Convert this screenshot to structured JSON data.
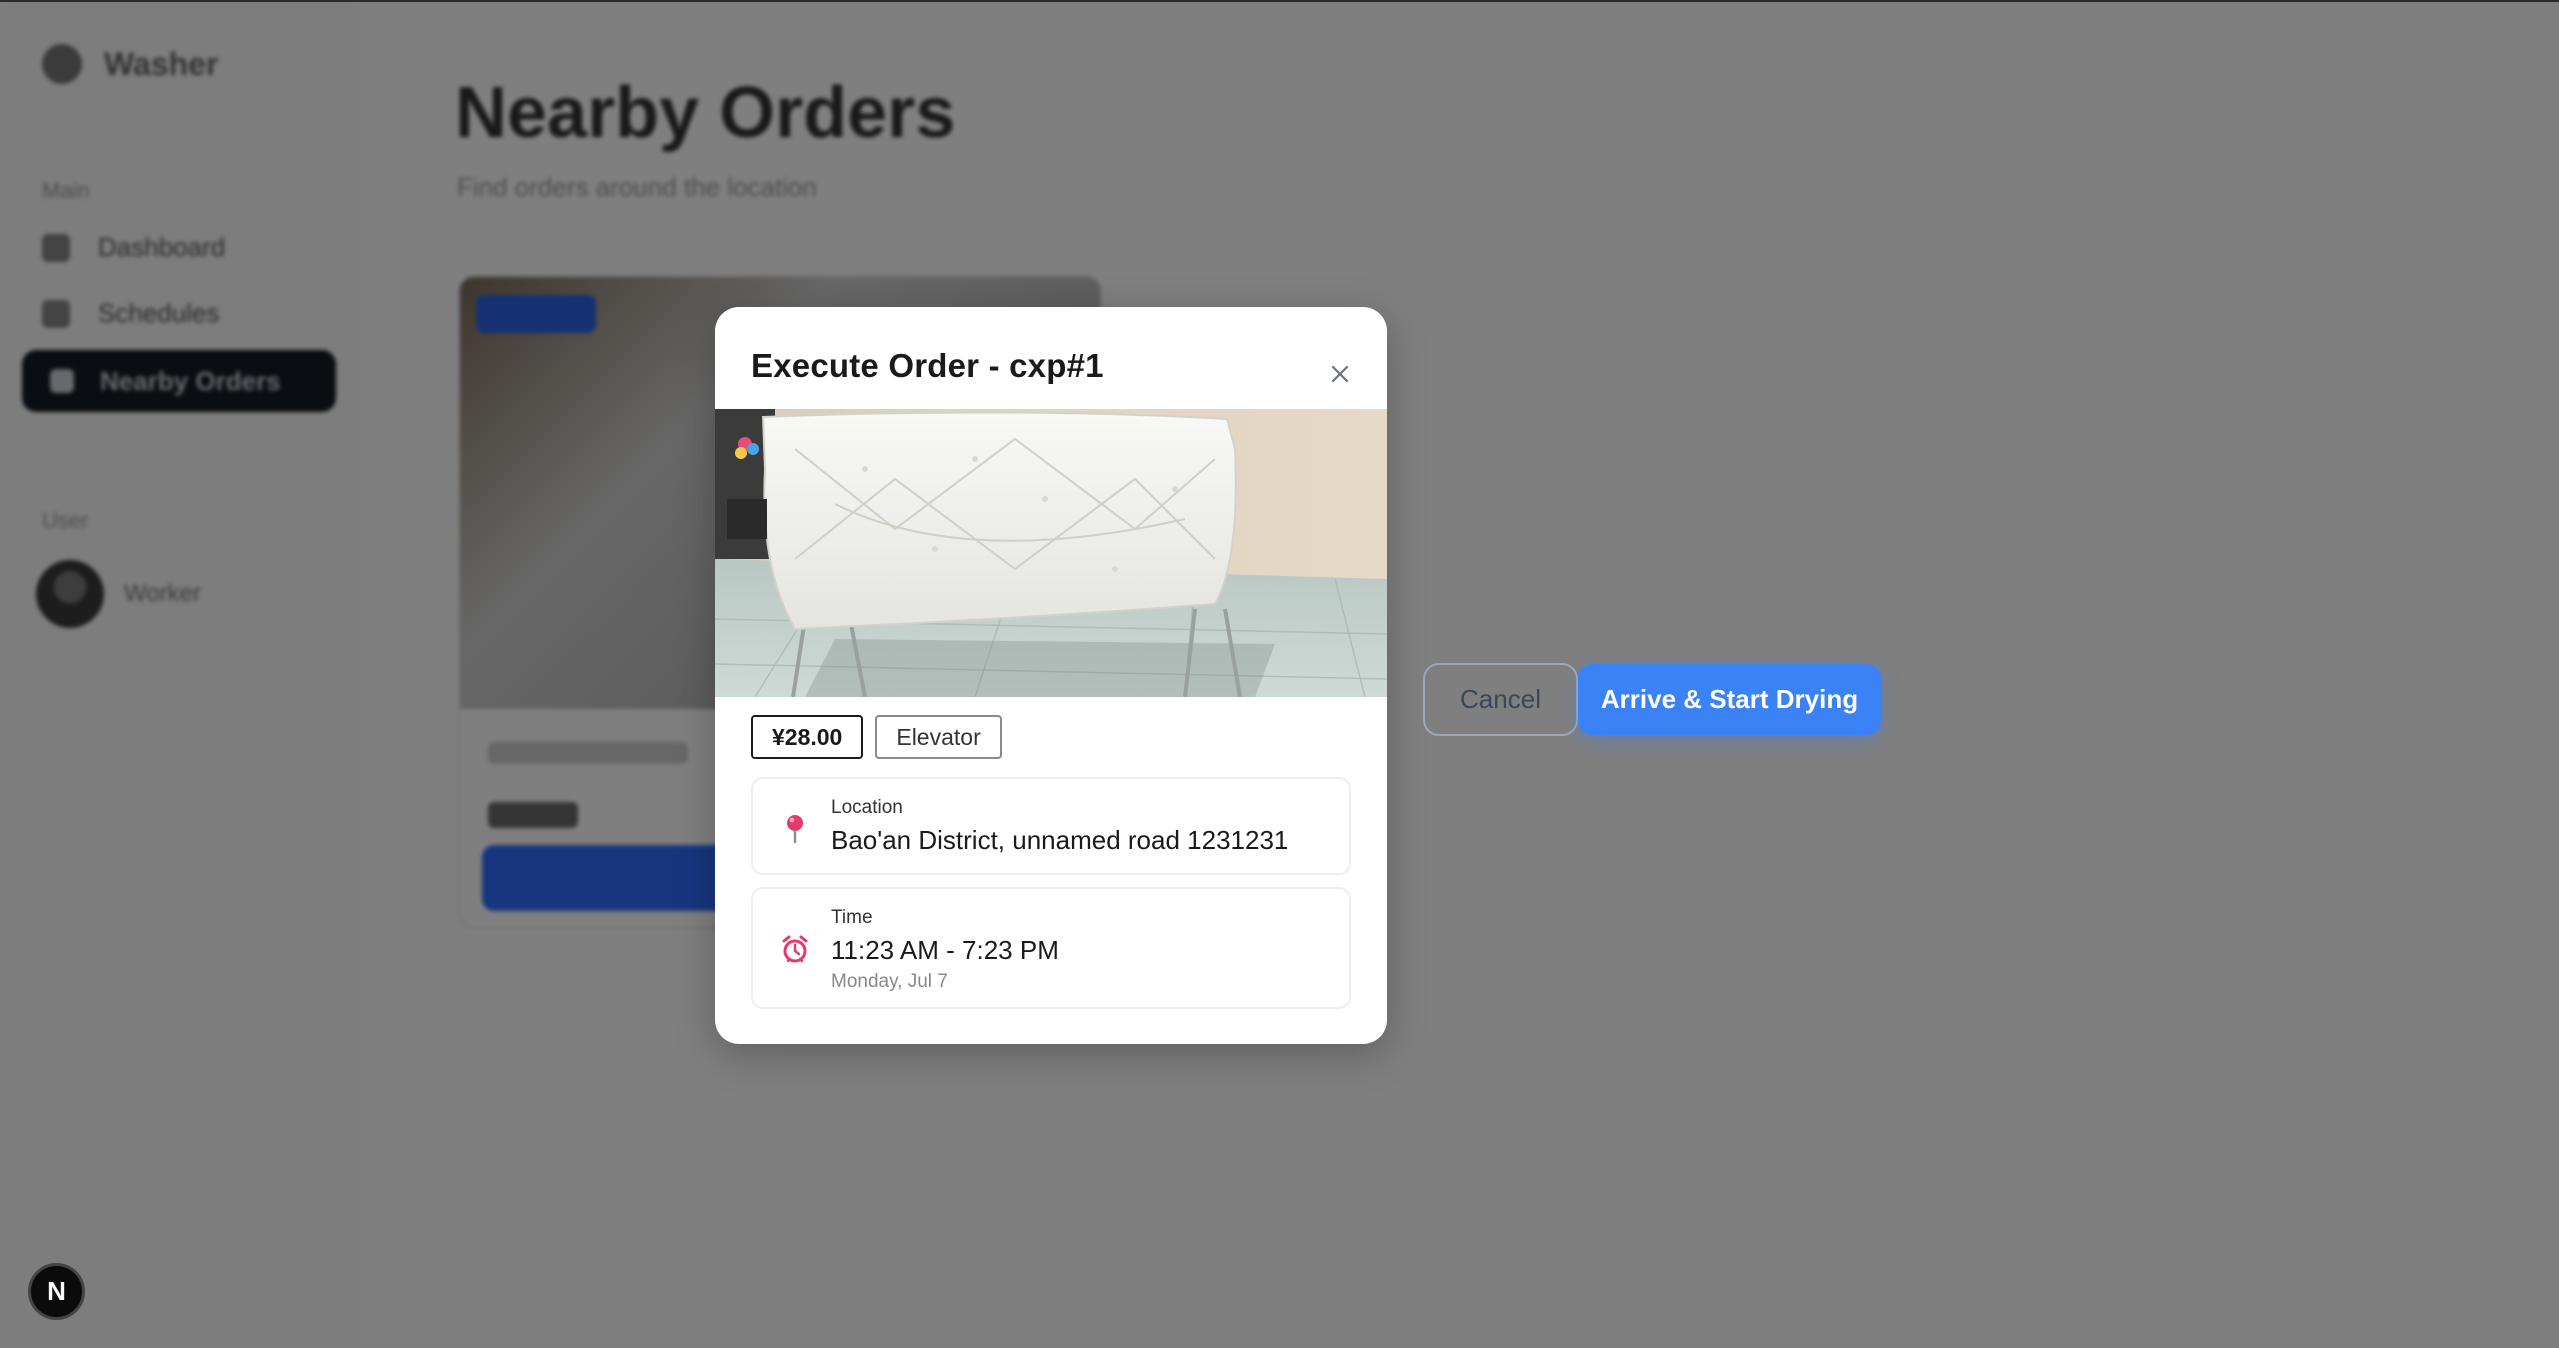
{
  "app": {
    "brand_name": "Washer",
    "nav_group_label": "Main",
    "nav_items": [
      {
        "label": "Dashboard",
        "icon": "grid-icon"
      },
      {
        "label": "Schedules",
        "icon": "calendar-icon"
      },
      {
        "label": "Nearby Orders",
        "icon": "map-pin-icon",
        "active": true
      }
    ],
    "account_label": "User",
    "user_name": "Worker"
  },
  "page": {
    "title": "Nearby Orders",
    "subtitle": "Find orders around the location"
  },
  "dialog": {
    "title": "Execute Order - cxp#1",
    "price": "¥28.00",
    "tag": "Elevator",
    "location": {
      "label": "Location",
      "value": "Bao'an District, unnamed road 1231231"
    },
    "time": {
      "label": "Time",
      "value": "11:23 AM - 7:23 PM",
      "date": "Monday, Jul 7"
    }
  },
  "actions": {
    "cancel_label": "Cancel",
    "confirm_label": "Arrive & Start Drying"
  },
  "dev_indicator": {
    "label": "N"
  },
  "colors": {
    "primary": "#3b82f6",
    "overlay": "rgba(0,0,0,0.5)",
    "active_nav": "#151a24"
  }
}
